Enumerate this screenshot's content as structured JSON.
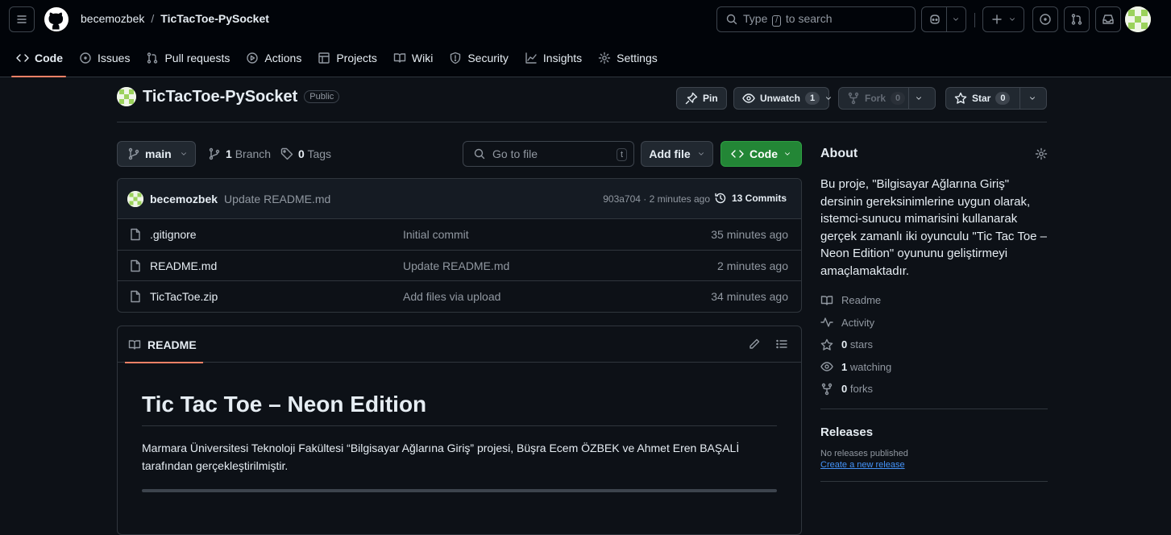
{
  "header": {
    "owner": "becemozbek",
    "separator": "/",
    "repo": "TicTacToe-PySocket",
    "search_prefix": "Type",
    "search_key": "/",
    "search_suffix": "to search"
  },
  "tabs": [
    {
      "label": "Code"
    },
    {
      "label": "Issues"
    },
    {
      "label": "Pull requests"
    },
    {
      "label": "Actions"
    },
    {
      "label": "Projects"
    },
    {
      "label": "Wiki"
    },
    {
      "label": "Security"
    },
    {
      "label": "Insights"
    },
    {
      "label": "Settings"
    }
  ],
  "repo_header": {
    "name": "TicTacToe-PySocket",
    "visibility": "Public",
    "pin_label": "Pin",
    "unwatch_label": "Unwatch",
    "unwatch_count": "1",
    "fork_label": "Fork",
    "fork_count": "0",
    "star_label": "Star",
    "star_count": "0"
  },
  "file_nav": {
    "branch": "main",
    "branch_count": "1",
    "branch_label": "Branch",
    "tag_count": "0",
    "tag_label": "Tags",
    "goto_placeholder": "Go to file",
    "goto_key": "t",
    "add_file_label": "Add file",
    "code_label": "Code"
  },
  "latest_commit": {
    "author": "becemozbek",
    "message": "Update README.md",
    "hash_time": "903a704 · 2 minutes ago",
    "commits_label": "13 Commits"
  },
  "files": [
    {
      "name": ".gitignore",
      "message": "Initial commit",
      "time": "35 minutes ago"
    },
    {
      "name": "README.md",
      "message": "Update README.md",
      "time": "2 minutes ago"
    },
    {
      "name": "TicTacToe.zip",
      "message": "Add files via upload",
      "time": "34 minutes ago"
    }
  ],
  "readme": {
    "tab_label": "README",
    "title": "Tic Tac Toe – Neon Edition",
    "paragraph": "Marmara Üniversitesi Teknoloji Fakültesi “Bilgisayar Ağlarına Giriş” projesi, Büşra Ecem ÖZBEK ve Ahmet Eren BAŞALİ tarafından gerçekleştirilmiştir."
  },
  "about": {
    "heading": "About",
    "description": "Bu proje, \"Bilgisayar Ağlarına Giriş\" dersinin gereksinimlerine uygun olarak, istemci-sunucu mimarisini kullanarak gerçek zamanlı iki oyunculu \"Tic Tac Toe – Neon Edition\" oyununu geliştirmeyi amaçlamaktadır.",
    "readme_label": "Readme",
    "activity_label": "Activity",
    "stars_count": "0",
    "stars_label": "stars",
    "watching_count": "1",
    "watching_label": "watching",
    "forks_count": "0",
    "forks_label": "forks"
  },
  "releases": {
    "heading": "Releases",
    "none_text": "No releases published",
    "create_link": "Create a new release"
  },
  "colors": {
    "accent_tab": "#f78166",
    "code_button": "#238636",
    "link": "#4493f8",
    "background": "#0d1117"
  }
}
